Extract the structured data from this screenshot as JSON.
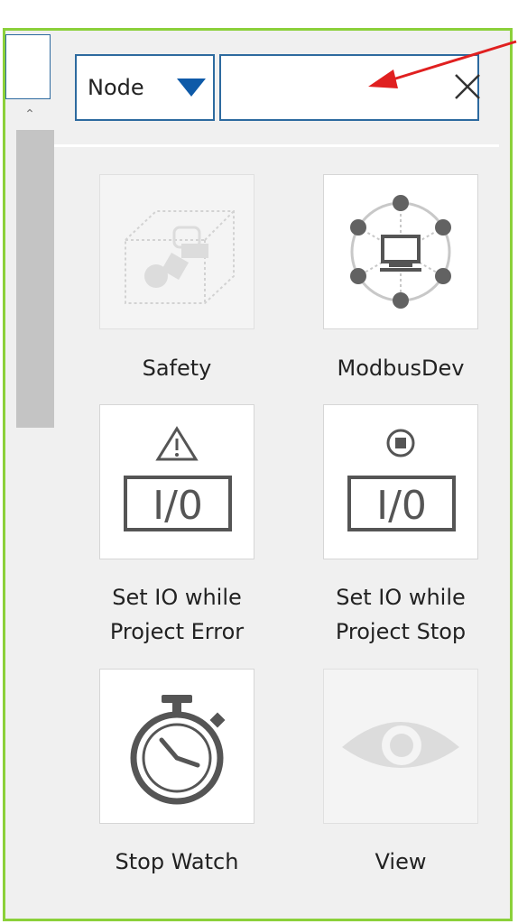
{
  "filter": {
    "selected": "Node",
    "search_value": ""
  },
  "items": [
    {
      "label": "Safety",
      "icon": "safety-icon",
      "enabled": false
    },
    {
      "label": "ModbusDev",
      "icon": "modbus-network-icon",
      "enabled": true
    },
    {
      "label": "Set IO while\nProject Error",
      "icon": "io-warning-icon",
      "enabled": true
    },
    {
      "label": "Set IO while\nProject Stop",
      "icon": "io-stop-icon",
      "enabled": true
    },
    {
      "label": "Stop Watch",
      "icon": "stopwatch-icon",
      "enabled": true
    },
    {
      "label": "View",
      "icon": "eye-icon",
      "enabled": false
    }
  ],
  "colors": {
    "highlight_border": "#8bd03a",
    "accent": "#2d6a9f",
    "annotation_arrow": "#e02020"
  }
}
